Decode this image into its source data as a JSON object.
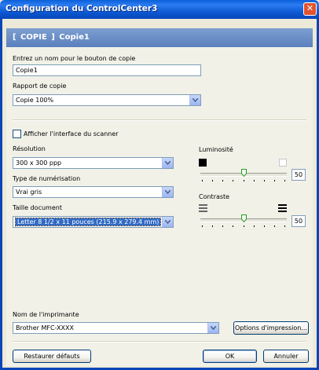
{
  "window": {
    "title": "Configuration du ControlCenter3",
    "close_glyph": "✕"
  },
  "header": {
    "title": "[ COPIE ]   Copie1"
  },
  "copy_name": {
    "label": "Entrez un nom pour le bouton de copie",
    "value": "Copie1"
  },
  "copy_ratio": {
    "label": "Rapport de copie",
    "value": "Copie 100%"
  },
  "scanner_interface": {
    "label": "Afficher l'interface du scanner",
    "checked": false
  },
  "resolution": {
    "label": "Résolution",
    "value": "300 x 300 ppp"
  },
  "scan_type": {
    "label": "Type de numérisation",
    "value": "Vrai gris"
  },
  "document_size": {
    "label": "Taille document",
    "value": "Letter 8 1/2 x 11 pouces (215.9 x 279.4 mm)"
  },
  "brightness": {
    "label": "Luminosité",
    "value": "50"
  },
  "contrast": {
    "label": "Contraste",
    "value": "50"
  },
  "printer": {
    "label": "Nom de l'imprimante",
    "value": "Brother MFC-XXXX",
    "options_button": "Options d'impression..."
  },
  "footer": {
    "restore_button": "Restaurer défauts",
    "ok_button": "OK",
    "cancel_button": "Annuler"
  },
  "colors": {
    "titlebar": "#0a55d0",
    "header_band": "#6a8dc6",
    "panel": "#f2f1e8",
    "selection": "#316ac5"
  }
}
